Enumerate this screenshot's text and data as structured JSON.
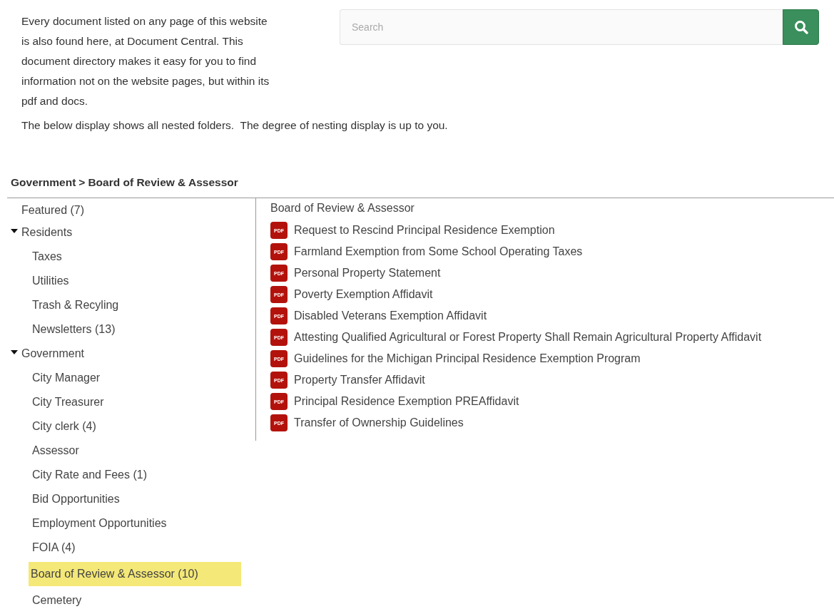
{
  "intro": "Every document listed on any page of this website is also found here, at Document Central. This document directory makes it easy for you to find information not on the website pages, but within its pdf and docs.",
  "note": "The below display shows all nested folders.  The degree of nesting display is up to you.",
  "search": {
    "placeholder": "Search"
  },
  "breadcrumb": [
    "Government",
    "Board of Review & Assessor"
  ],
  "breadcrumb_separator": ">",
  "folders": [
    {
      "label": "Featured (7)",
      "selected": false
    },
    {
      "label": "Residents",
      "expanded": true,
      "selected": false,
      "children": [
        {
          "label": "Taxes",
          "selected": false
        },
        {
          "label": "Utilities",
          "selected": false
        },
        {
          "label": "Trash & Recyling",
          "selected": false
        },
        {
          "label": "Newsletters (13)",
          "selected": false
        }
      ]
    },
    {
      "label": "Government",
      "expanded": true,
      "selected": false,
      "children": [
        {
          "label": "City Manager",
          "selected": false
        },
        {
          "label": "City Treasurer",
          "selected": false
        },
        {
          "label": "City clerk (4)",
          "selected": false
        },
        {
          "label": "Assessor",
          "selected": false
        },
        {
          "label": "City Rate and Fees (1)",
          "selected": false
        },
        {
          "label": "Bid Opportunities",
          "selected": false
        },
        {
          "label": "Employment Opportunities",
          "selected": false
        },
        {
          "label": "FOIA (4)",
          "selected": false
        },
        {
          "label": "Board of Review & Assessor (10)",
          "selected": true
        },
        {
          "label": "Cemetery",
          "selected": false
        }
      ]
    }
  ],
  "documents_title": "Board of Review & Assessor",
  "documents": [
    {
      "file_type": "PDF",
      "title": "Request to Rescind Principal Residence Exemption"
    },
    {
      "file_type": "PDF",
      "title": "Farmland Exemption from Some School Operating Taxes"
    },
    {
      "file_type": "PDF",
      "title": "Personal Property Statement"
    },
    {
      "file_type": "PDF",
      "title": "Poverty Exemption Affidavit"
    },
    {
      "file_type": "PDF",
      "title": "Disabled Veterans Exemption Affidavit"
    },
    {
      "file_type": "PDF",
      "title": "Attesting Qualified Agricultural or Forest Property Shall Remain Agricultural Property Affidavit"
    },
    {
      "file_type": "PDF",
      "title": "Guidelines for the Michigan Principal Residence Exemption Program"
    },
    {
      "file_type": "PDF",
      "title": "Property Transfer Affidavit"
    },
    {
      "file_type": "PDF",
      "title": "Principal Residence Exemption PREAffidavit"
    },
    {
      "file_type": "PDF",
      "title": "Transfer of Ownership Guidelines"
    }
  ]
}
